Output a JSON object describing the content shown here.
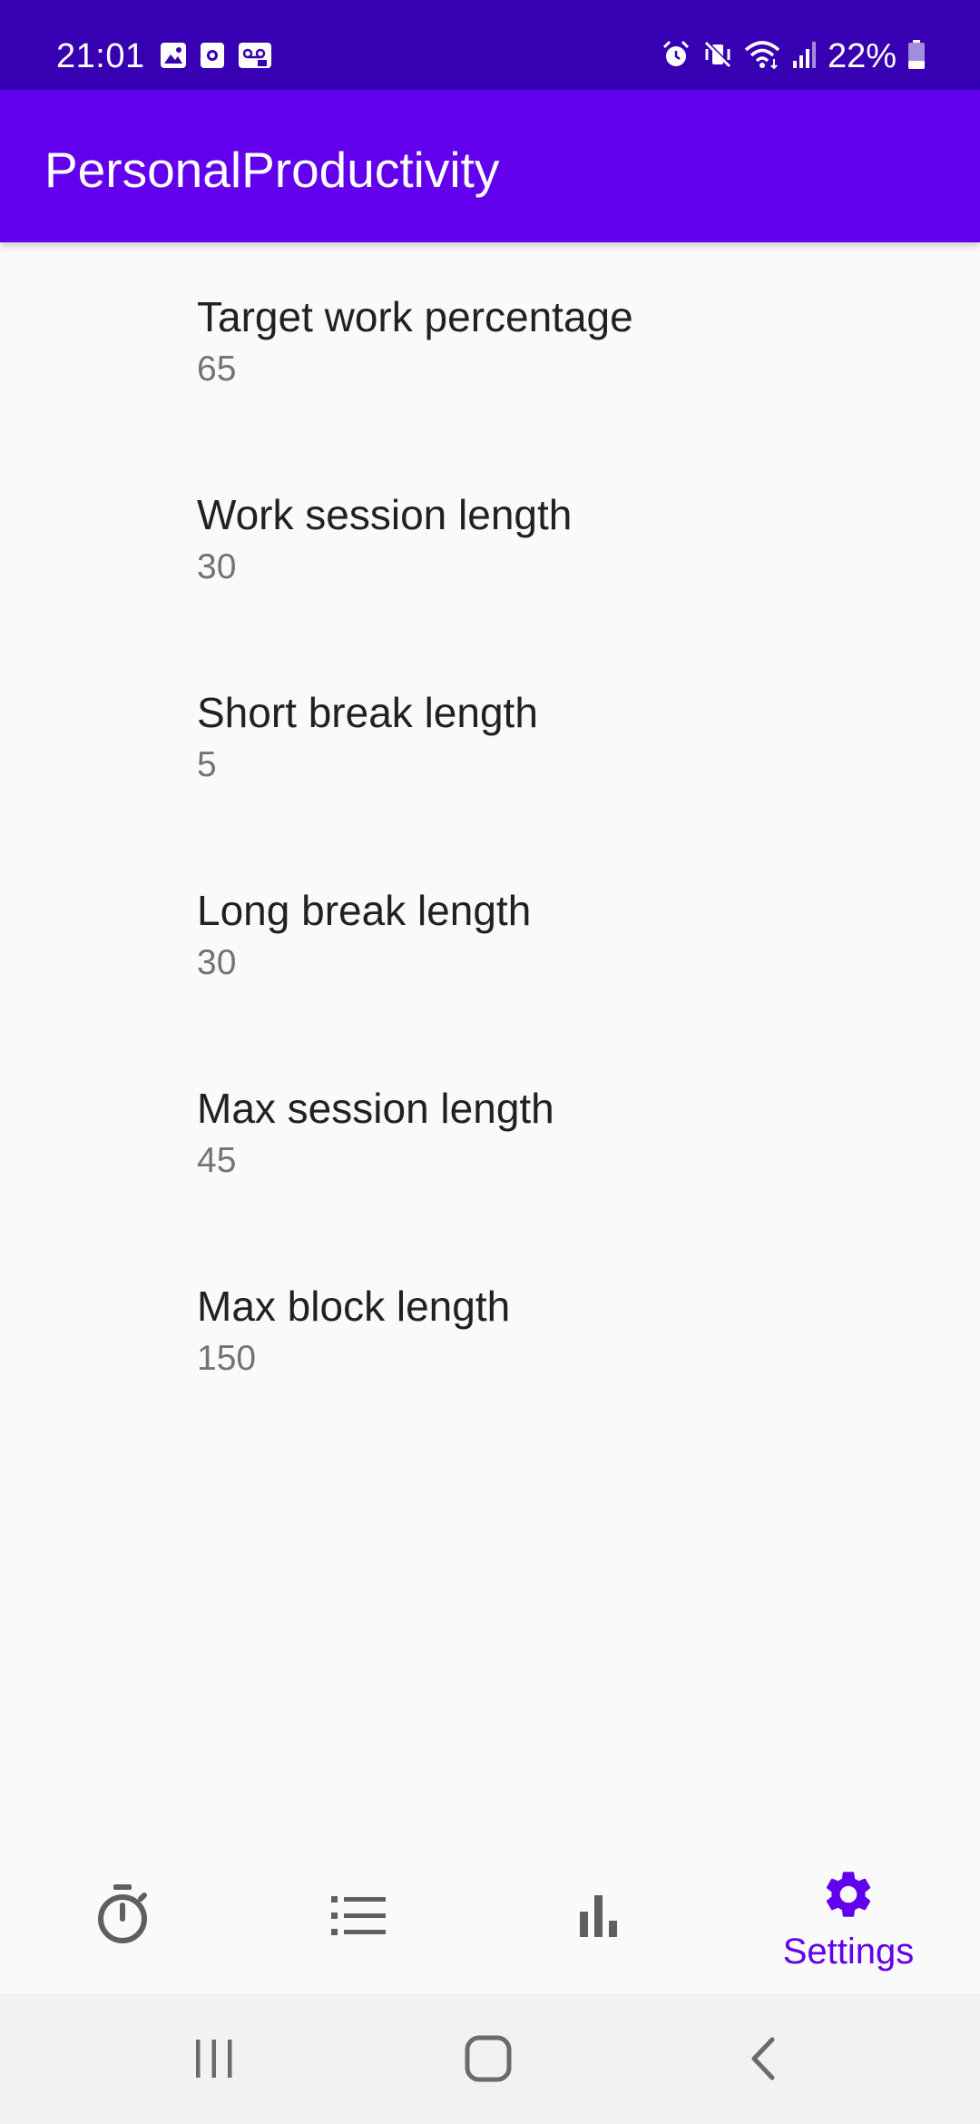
{
  "status_bar": {
    "time": "21:01",
    "battery": "22%",
    "left_icons": [
      "image-icon",
      "screen-record-icon",
      "voicemail-icon"
    ],
    "right_icons": [
      "alarm-icon",
      "vibrate-off-icon",
      "wifi-icon",
      "signal-icon",
      "battery-icon"
    ]
  },
  "app_bar": {
    "title": "PersonalProductivity"
  },
  "preferences": [
    {
      "title": "Target work percentage",
      "value": "65"
    },
    {
      "title": "Work session length",
      "value": "30"
    },
    {
      "title": "Short break length",
      "value": "5"
    },
    {
      "title": "Long break length",
      "value": "30"
    },
    {
      "title": "Max session length",
      "value": "45"
    },
    {
      "title": "Max block length",
      "value": "150"
    }
  ],
  "bottom_nav": {
    "items": [
      {
        "icon": "timer-icon",
        "label": ""
      },
      {
        "icon": "list-icon",
        "label": ""
      },
      {
        "icon": "bar-chart-icon",
        "label": ""
      },
      {
        "icon": "settings-icon",
        "label": "Settings",
        "selected": true
      }
    ]
  },
  "system_nav": {
    "buttons": [
      "recents-icon",
      "home-icon",
      "back-icon"
    ]
  },
  "colors": {
    "status_bar": "#3700b3",
    "app_bar": "#6200ee",
    "accent": "#6200ee",
    "background": "#fafafa",
    "primary_text": "#212121",
    "secondary_text": "#737373",
    "nav_icon_inactive": "#5f5f5f"
  }
}
